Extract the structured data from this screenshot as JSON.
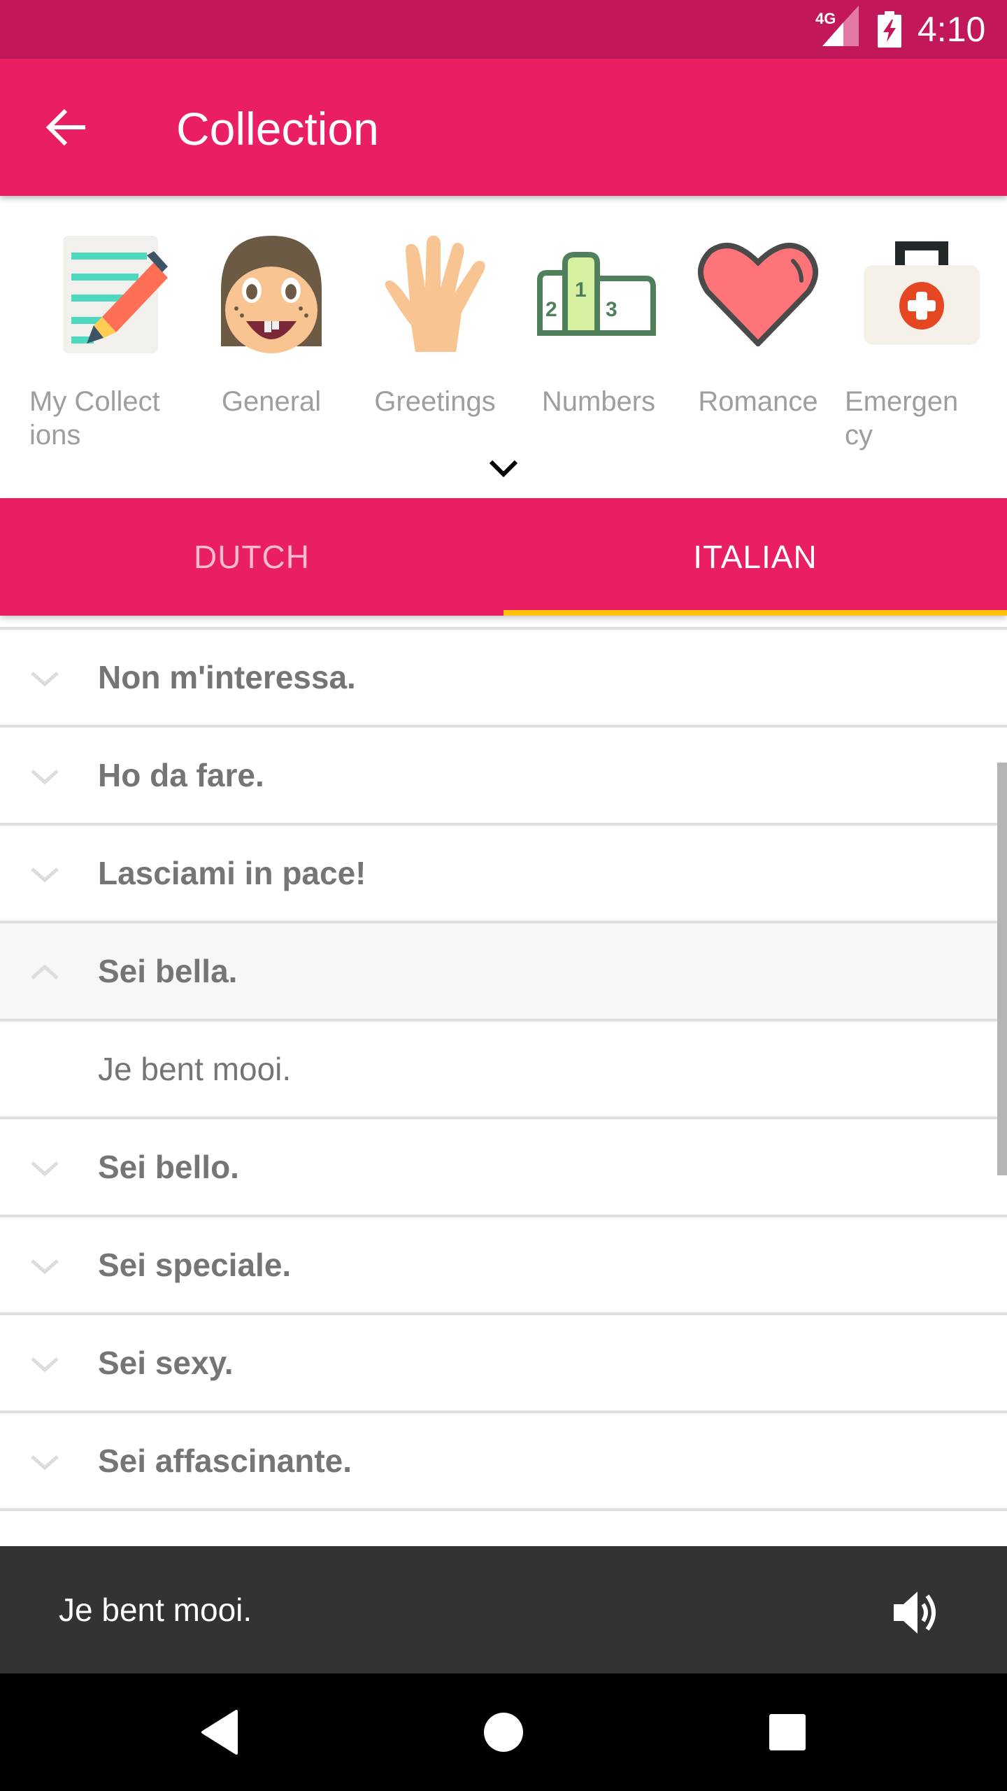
{
  "status_bar": {
    "network": "4G",
    "time": "4:10",
    "icons": [
      "signal-icon",
      "battery-charging-icon"
    ]
  },
  "toolbar": {
    "back_icon": "arrow-back-icon",
    "title": "Collection"
  },
  "categories": {
    "items": [
      {
        "label": "My Collect ions",
        "icon": "notepad-pencil-icon"
      },
      {
        "label": "General",
        "icon": "face-icon"
      },
      {
        "label": "Greetings",
        "icon": "waving-hand-icon"
      },
      {
        "label": "Numbers",
        "icon": "podium-icon"
      },
      {
        "label": "Romance",
        "icon": "heart-icon"
      },
      {
        "label": "Emergen cy",
        "icon": "first-aid-kit-icon"
      }
    ],
    "expand_icon": "chevron-down-icon"
  },
  "tabs": {
    "items": [
      {
        "label": "DUTCH",
        "selected": false
      },
      {
        "label": "ITALIAN",
        "selected": true
      }
    ],
    "indicator_color": "#ffc107"
  },
  "phrases": {
    "items": [
      {
        "text": "Non m'interessa.",
        "expanded": false
      },
      {
        "text": "Ho da fare.",
        "expanded": false
      },
      {
        "text": "Lasciami in pace!",
        "expanded": false
      },
      {
        "text": "Sei bella.",
        "expanded": true,
        "translation": "Je bent mooi."
      },
      {
        "text": "Sei bello.",
        "expanded": false
      },
      {
        "text": "Sei speciale.",
        "expanded": false
      },
      {
        "text": "Sei sexy.",
        "expanded": false
      },
      {
        "text": "Sei affascinante.",
        "expanded": false
      }
    ]
  },
  "player": {
    "text": "Je bent mooi.",
    "speaker_icon": "volume-up-icon"
  },
  "navbar": {
    "buttons": [
      "back-nav-icon",
      "home-nav-icon",
      "recents-nav-icon"
    ]
  },
  "colors": {
    "primary": "#e91e63",
    "primary_dark": "#c2185b",
    "accent": "#ffc107",
    "player_bg": "#333333"
  }
}
